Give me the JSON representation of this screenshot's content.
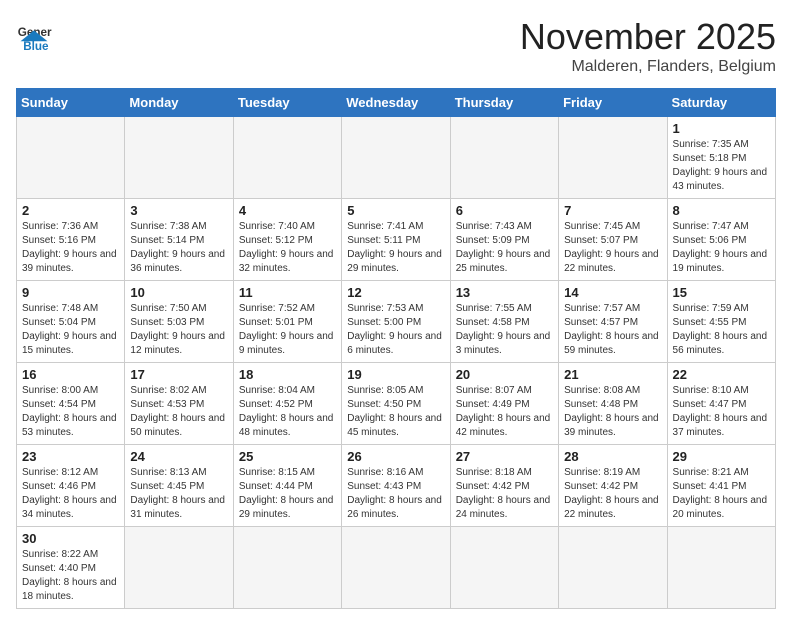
{
  "header": {
    "logo_general": "General",
    "logo_blue": "Blue",
    "month_title": "November 2025",
    "location": "Malderen, Flanders, Belgium"
  },
  "weekdays": [
    "Sunday",
    "Monday",
    "Tuesday",
    "Wednesday",
    "Thursday",
    "Friday",
    "Saturday"
  ],
  "weeks": [
    [
      {
        "day": "",
        "info": ""
      },
      {
        "day": "",
        "info": ""
      },
      {
        "day": "",
        "info": ""
      },
      {
        "day": "",
        "info": ""
      },
      {
        "day": "",
        "info": ""
      },
      {
        "day": "",
        "info": ""
      },
      {
        "day": "1",
        "info": "Sunrise: 7:35 AM\nSunset: 5:18 PM\nDaylight: 9 hours and 43 minutes."
      }
    ],
    [
      {
        "day": "2",
        "info": "Sunrise: 7:36 AM\nSunset: 5:16 PM\nDaylight: 9 hours and 39 minutes."
      },
      {
        "day": "3",
        "info": "Sunrise: 7:38 AM\nSunset: 5:14 PM\nDaylight: 9 hours and 36 minutes."
      },
      {
        "day": "4",
        "info": "Sunrise: 7:40 AM\nSunset: 5:12 PM\nDaylight: 9 hours and 32 minutes."
      },
      {
        "day": "5",
        "info": "Sunrise: 7:41 AM\nSunset: 5:11 PM\nDaylight: 9 hours and 29 minutes."
      },
      {
        "day": "6",
        "info": "Sunrise: 7:43 AM\nSunset: 5:09 PM\nDaylight: 9 hours and 25 minutes."
      },
      {
        "day": "7",
        "info": "Sunrise: 7:45 AM\nSunset: 5:07 PM\nDaylight: 9 hours and 22 minutes."
      },
      {
        "day": "8",
        "info": "Sunrise: 7:47 AM\nSunset: 5:06 PM\nDaylight: 9 hours and 19 minutes."
      }
    ],
    [
      {
        "day": "9",
        "info": "Sunrise: 7:48 AM\nSunset: 5:04 PM\nDaylight: 9 hours and 15 minutes."
      },
      {
        "day": "10",
        "info": "Sunrise: 7:50 AM\nSunset: 5:03 PM\nDaylight: 9 hours and 12 minutes."
      },
      {
        "day": "11",
        "info": "Sunrise: 7:52 AM\nSunset: 5:01 PM\nDaylight: 9 hours and 9 minutes."
      },
      {
        "day": "12",
        "info": "Sunrise: 7:53 AM\nSunset: 5:00 PM\nDaylight: 9 hours and 6 minutes."
      },
      {
        "day": "13",
        "info": "Sunrise: 7:55 AM\nSunset: 4:58 PM\nDaylight: 9 hours and 3 minutes."
      },
      {
        "day": "14",
        "info": "Sunrise: 7:57 AM\nSunset: 4:57 PM\nDaylight: 8 hours and 59 minutes."
      },
      {
        "day": "15",
        "info": "Sunrise: 7:59 AM\nSunset: 4:55 PM\nDaylight: 8 hours and 56 minutes."
      }
    ],
    [
      {
        "day": "16",
        "info": "Sunrise: 8:00 AM\nSunset: 4:54 PM\nDaylight: 8 hours and 53 minutes."
      },
      {
        "day": "17",
        "info": "Sunrise: 8:02 AM\nSunset: 4:53 PM\nDaylight: 8 hours and 50 minutes."
      },
      {
        "day": "18",
        "info": "Sunrise: 8:04 AM\nSunset: 4:52 PM\nDaylight: 8 hours and 48 minutes."
      },
      {
        "day": "19",
        "info": "Sunrise: 8:05 AM\nSunset: 4:50 PM\nDaylight: 8 hours and 45 minutes."
      },
      {
        "day": "20",
        "info": "Sunrise: 8:07 AM\nSunset: 4:49 PM\nDaylight: 8 hours and 42 minutes."
      },
      {
        "day": "21",
        "info": "Sunrise: 8:08 AM\nSunset: 4:48 PM\nDaylight: 8 hours and 39 minutes."
      },
      {
        "day": "22",
        "info": "Sunrise: 8:10 AM\nSunset: 4:47 PM\nDaylight: 8 hours and 37 minutes."
      }
    ],
    [
      {
        "day": "23",
        "info": "Sunrise: 8:12 AM\nSunset: 4:46 PM\nDaylight: 8 hours and 34 minutes."
      },
      {
        "day": "24",
        "info": "Sunrise: 8:13 AM\nSunset: 4:45 PM\nDaylight: 8 hours and 31 minutes."
      },
      {
        "day": "25",
        "info": "Sunrise: 8:15 AM\nSunset: 4:44 PM\nDaylight: 8 hours and 29 minutes."
      },
      {
        "day": "26",
        "info": "Sunrise: 8:16 AM\nSunset: 4:43 PM\nDaylight: 8 hours and 26 minutes."
      },
      {
        "day": "27",
        "info": "Sunrise: 8:18 AM\nSunset: 4:42 PM\nDaylight: 8 hours and 24 minutes."
      },
      {
        "day": "28",
        "info": "Sunrise: 8:19 AM\nSunset: 4:42 PM\nDaylight: 8 hours and 22 minutes."
      },
      {
        "day": "29",
        "info": "Sunrise: 8:21 AM\nSunset: 4:41 PM\nDaylight: 8 hours and 20 minutes."
      }
    ],
    [
      {
        "day": "30",
        "info": "Sunrise: 8:22 AM\nSunset: 4:40 PM\nDaylight: 8 hours and 18 minutes."
      },
      {
        "day": "",
        "info": ""
      },
      {
        "day": "",
        "info": ""
      },
      {
        "day": "",
        "info": ""
      },
      {
        "day": "",
        "info": ""
      },
      {
        "day": "",
        "info": ""
      },
      {
        "day": "",
        "info": ""
      }
    ]
  ]
}
